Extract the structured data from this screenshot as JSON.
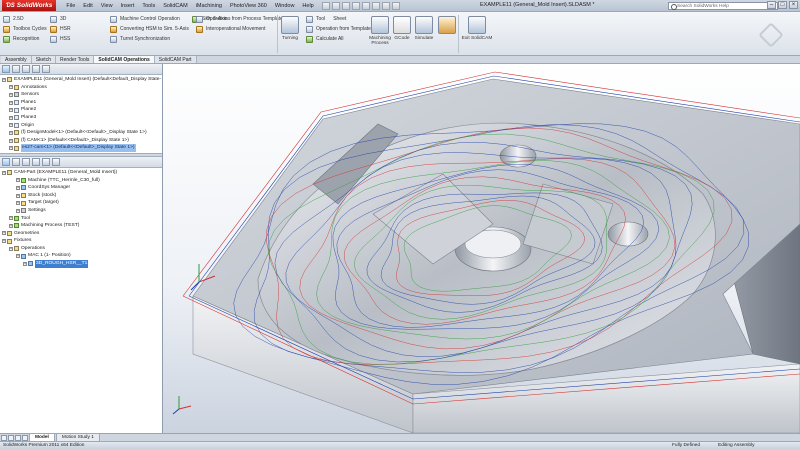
{
  "titlebar": {
    "brand": "SolidWorks",
    "menu": [
      "File",
      "Edit",
      "View",
      "Insert",
      "Tools",
      "SolidCAM",
      "iMachining",
      "PhotoView 360",
      "Window",
      "Help"
    ],
    "document_title": "EXAMPLE11 (General_Mold Insert).SLDASM *",
    "search_placeholder": "Search SolidWorks Help"
  },
  "ribbon": {
    "col1": [
      "2.5D",
      "Toolbox Cycles",
      "Recognition"
    ],
    "col2": [
      "3D",
      "HSR",
      "HSS"
    ],
    "col3": [
      "Machine Control Operation",
      "Converting HSM to Sim. 5-Axis",
      "Turret Synchronization"
    ],
    "col4": [
      "Sim. 5-Axis"
    ],
    "col5": [
      "Operations from Process Template",
      "Interoperational Movement"
    ],
    "turning": "Turning",
    "col6": [
      "Tool",
      "Operation from Template",
      "Calculate All"
    ],
    "sheet": "Sheet",
    "machining_process": "Machining Process",
    "gcode": "GCode",
    "simulate": "Simulate",
    "exit_solidcam": "Exit SolidCAM"
  },
  "command_tabs": [
    "Assembly",
    "Sketch",
    "Render Tools",
    "SolidCAM Operations",
    "SolidCAM Part"
  ],
  "feature_tree": [
    {
      "text": "EXAMPLE11 (General_Mold Insert)  (Default<Default_Display State-",
      "icon": "assembly",
      "indent": 0
    },
    {
      "text": "Annotations",
      "icon": "annotations",
      "indent": 1
    },
    {
      "text": "Sensors",
      "icon": "sensors",
      "indent": 1
    },
    {
      "text": "Plane1",
      "icon": "plane",
      "indent": 1
    },
    {
      "text": "Plane2",
      "icon": "plane",
      "indent": 1
    },
    {
      "text": "Plane3",
      "icon": "plane",
      "indent": 1
    },
    {
      "text": "Origin",
      "icon": "origin",
      "indent": 1
    },
    {
      "text": "(f) DesignModel<1> (Default<<Default>_Display State 1>)",
      "icon": "part",
      "indent": 1
    },
    {
      "text": "(f) CAM<1> (Default<<Default>_Display State 1>)",
      "icon": "part",
      "indent": 1
    },
    {
      "text": "es27-cam<1> (Default<<Default>_Display State 1>)",
      "icon": "part",
      "indent": 1,
      "selected": true
    }
  ],
  "cam_tree": [
    {
      "text": "CAM-Part (EXAMPLE11 (General_Mold Insert))",
      "icon": "cam-part",
      "indent": 0
    },
    {
      "text": "Machine (TTC_Hermle_C30_full)",
      "icon": "machine",
      "indent": 2
    },
    {
      "text": "CoordSys Manager",
      "icon": "coordsys",
      "indent": 2
    },
    {
      "text": "Stock (stock)",
      "icon": "stock",
      "indent": 2
    },
    {
      "text": "Target (target)",
      "icon": "target",
      "indent": 2
    },
    {
      "text": "Settings",
      "icon": "settings",
      "indent": 2
    },
    {
      "text": "Tool",
      "icon": "tool",
      "indent": 1
    },
    {
      "text": "Machining Process (TEST)",
      "icon": "machining-process",
      "indent": 1
    },
    {
      "text": "Geometries",
      "icon": "geometries",
      "indent": 0
    },
    {
      "text": "Fixtures",
      "icon": "fixtures",
      "indent": 0
    },
    {
      "text": "Operations",
      "icon": "operations",
      "indent": 1
    },
    {
      "text": "MAC 1 (1- Position)",
      "icon": "mac",
      "indent": 2
    },
    {
      "text": "3D_ROUGH_HSR__T1",
      "icon": "operation",
      "indent": 3,
      "highlighted": true
    }
  ],
  "bottom_tabs": [
    "Model",
    "Motion Study 1"
  ],
  "status": {
    "product": "SolidWorks Premium 2011 x64 Edition",
    "state": "Fully Defined",
    "mode": "Editing Assembly"
  },
  "colors": {
    "highlight": "#3f7fd1",
    "toolpath_blue": "#1f3fa8",
    "toolpath_red": "#d23030",
    "toolpath_green": "#2e9e3a",
    "model_gray": "#b9bec6"
  }
}
